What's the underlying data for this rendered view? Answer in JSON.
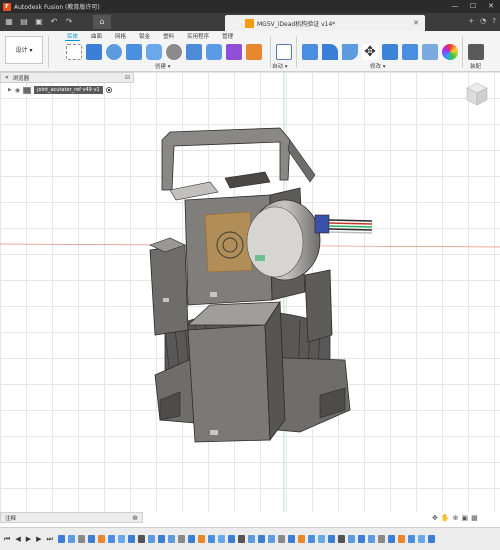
{
  "app": {
    "title": "Autodesk Fusion (教育版许可)",
    "logo_letter": "F"
  },
  "window_controls": [
    "—",
    "☐",
    "✕"
  ],
  "document_tab": {
    "title": "MG5V_iDead机构验证 v14*",
    "close": "✕"
  },
  "ribbon": {
    "design_label": "设计 ▾",
    "tabs": [
      "实体",
      "曲面",
      "网格",
      "钣金",
      "塑料",
      "实用程序",
      "管理"
    ],
    "active_tab": "实体",
    "groups": {
      "create": "创建 ▾",
      "automate": "自动 ▾",
      "modify": "修改 ▾",
      "assemble": "装配"
    }
  },
  "browser": {
    "header": "浏览器",
    "items": [
      {
        "name": "joint_acutator_ref v49 v1"
      }
    ]
  },
  "comments": {
    "label": "注释"
  },
  "colors": {
    "titlebar": "#2b2b2b",
    "accent": "#0696d7",
    "body_gray": "#6f6d6a",
    "highlight_orange": "#d89a3a"
  }
}
